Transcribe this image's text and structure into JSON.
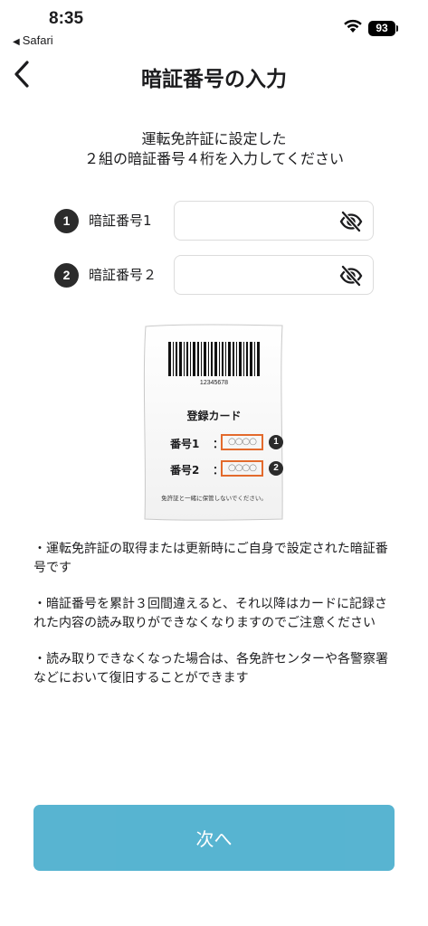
{
  "status_bar": {
    "time": "8:35",
    "back_app": "Safari",
    "battery": "93"
  },
  "header": {
    "title": "暗証番号の入力"
  },
  "instruction": {
    "line1": "運転免許証に設定した",
    "line2": "２組の暗証番号４桁を入力してください"
  },
  "pins": [
    {
      "number": "1",
      "label": "暗証番号1",
      "value": "",
      "placeholder": ""
    },
    {
      "number": "2",
      "label": "暗証番号２",
      "value": "",
      "placeholder": ""
    }
  ],
  "card": {
    "barcode_number": "12345678",
    "title": "登録カード",
    "rows": [
      {
        "label": "番号1",
        "colon": "：",
        "boxes": "○○○○",
        "number": "1"
      },
      {
        "label": "番号2",
        "colon": "：",
        "boxes": "○○○○",
        "number": "2"
      }
    ],
    "note": "免許証と一緒に保管しないでください。"
  },
  "notes": [
    "・運転免許証の取得または更新時にご自身で設定された暗証番号です",
    "・暗証番号を累計３回間違えると、それ以降はカードに記録された内容の読み取りができなくなりますのでご注意ください",
    "・読み取りできなくなった場合は、各免許センターや各警察署などにおいて復旧することができます"
  ],
  "button": {
    "next_label": "次へ"
  },
  "colors": {
    "accent_button": "#4fb0cf",
    "badge": "#2b2b2b",
    "card_box": "#e36a2c"
  }
}
